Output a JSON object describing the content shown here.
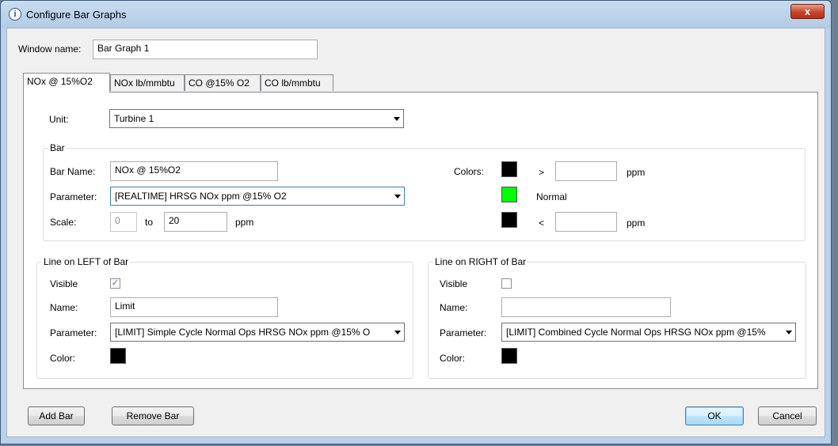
{
  "window": {
    "title": "Configure Bar Graphs",
    "close_label": "x"
  },
  "window_name": {
    "label": "Window name:",
    "value": "Bar Graph 1"
  },
  "tabs": [
    {
      "label": "NOx @ 15%O2",
      "active": true
    },
    {
      "label": "NOx lb/mmbtu",
      "active": false
    },
    {
      "label": "CO @15% O2",
      "active": false
    },
    {
      "label": "CO lb/mmbtu",
      "active": false
    }
  ],
  "unit": {
    "label": "Unit:",
    "value": "Turbine 1"
  },
  "bar": {
    "group_title": "Bar",
    "name_label": "Bar Name:",
    "name_value": "NOx @ 15%O2",
    "parameter_label": "Parameter:",
    "parameter_value": "[REALTIME] HRSG NOx ppm @15% O2",
    "scale_label": "Scale:",
    "scale_min": "0",
    "scale_to_label": "to",
    "scale_max": "20",
    "scale_unit": "ppm",
    "colors_label": "Colors:",
    "above": {
      "symbol": ">",
      "value": "",
      "unit": "ppm",
      "color": "#000000"
    },
    "normal": {
      "label": "Normal",
      "color": "#00ff00"
    },
    "below": {
      "symbol": "<",
      "value": "",
      "unit": "ppm",
      "color": "#000000"
    }
  },
  "left_line": {
    "group_title": "Line on LEFT of Bar",
    "visible_label": "Visible",
    "visible_checked": true,
    "check_mark": "✓",
    "name_label": "Name:",
    "name_value": "Limit",
    "parameter_label": "Parameter:",
    "parameter_value": "[LIMIT] Simple Cycle Normal Ops HRSG NOx ppm @15% O",
    "color_label": "Color:",
    "color": "#000000"
  },
  "right_line": {
    "group_title": "Line on RIGHT of Bar",
    "visible_label": "Visible",
    "visible_checked": false,
    "name_label": "Name:",
    "name_value": "",
    "parameter_label": "Parameter:",
    "parameter_value": "[LIMIT] Combined Cycle Normal Ops HRSG NOx ppm @15%",
    "color_label": "Color:",
    "color": "#000000"
  },
  "buttons": {
    "add_bar": "Add Bar",
    "remove_bar": "Remove Bar",
    "ok": "OK",
    "cancel": "Cancel"
  }
}
